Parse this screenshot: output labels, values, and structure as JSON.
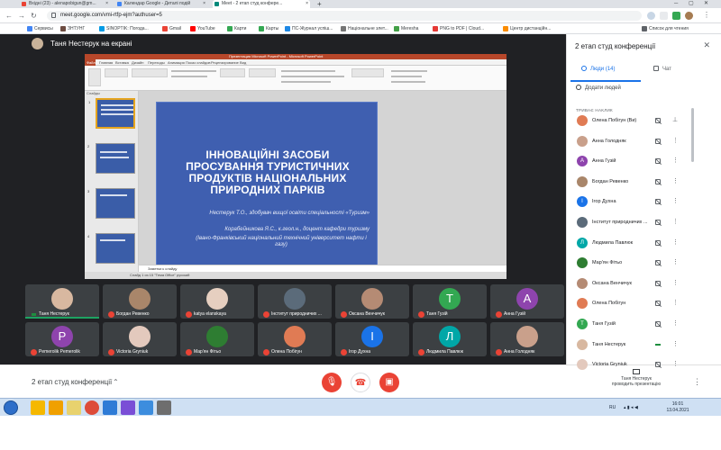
{
  "browser": {
    "tabs": [
      {
        "label": "Вхідні (23) - alenapobigun@gm...",
        "color": "#ea4335",
        "active": false
      },
      {
        "label": "Календар Google - Деталі подій",
        "color": "#4285f4",
        "active": false
      },
      {
        "label": "Meet - 2 етап студ конфере...",
        "color": "#00897b",
        "active": true
      }
    ],
    "new_tab": "+",
    "url": "meet.google.com/vmi-rtfp-ejm?authuser=5"
  },
  "bookmarks": [
    {
      "label": "Сервисы",
      "color": "#4285f4"
    },
    {
      "label": "ЗНТУНГ",
      "color": "#6d4c41"
    },
    {
      "label": "SINOPTIK: Погода...",
      "color": "#039be5"
    },
    {
      "label": "Gmail",
      "color": "#ea4335"
    },
    {
      "label": "YouTube",
      "color": "#ff0000"
    },
    {
      "label": "Карти",
      "color": "#34a853"
    },
    {
      "label": "Карты",
      "color": "#34a853"
    },
    {
      "label": "ПС-Журнал успіш...",
      "color": "#1e88e5"
    },
    {
      "label": "Національне злет...",
      "color": "#757575"
    },
    {
      "label": "Meresha",
      "color": "#43a047"
    },
    {
      "label": "PNG to PDF | Cloud...",
      "color": "#e53935"
    },
    {
      "label": "Центр дистанційн...",
      "color": "#fb8c00"
    },
    {
      "label": "Список для чтения",
      "color": "#5f6368"
    }
  ],
  "meet": {
    "presenter_label": "Таня Нестерук на екрані",
    "meeting_title": "2 етап студ конференції",
    "present_label_1": "Таня Нестерук",
    "present_label_2": "проводить презентацію"
  },
  "slide": {
    "app_title": "Презентация Microsoft PowerPoint - Microsoft PowerPoint",
    "tabs": [
      "Файл",
      "Главная",
      "Вставка",
      "Дизайн",
      "Переходы",
      "Анимация",
      "Показ слайдов",
      "Рецензирование",
      "Вид"
    ],
    "panel_header": "Слайды",
    "title_lines": [
      "ІННОВАЦІЙНІ ЗАСОБИ",
      "ПРОСУВАННЯ ТУРИСТИЧНИХ",
      "ПРОДУКТІВ НАЦІОНАЛЬНИХ",
      "ПРИРОДНИХ ПАРКІВ"
    ],
    "author_1": "Нестерук Т.О., здобувач вищої освіти спеціальності «Туризм»",
    "author_2": "Корабейникова Я.С., к.геол.н., доцент кафедри туризму",
    "author_3": "(Івано-Франківський національний технічний університет нафти і газу)",
    "notes": "Заметки к слайду",
    "status": "Слайд 1 из 15    \"Тема Office\"    русский"
  },
  "tiles": [
    {
      "name": "Таня Нестерук",
      "type": "photo",
      "color": "#d8b8a0",
      "speaking": true
    },
    {
      "name": "Богдан Ревенко",
      "type": "photo",
      "color": "#a9866a",
      "speaking": false
    },
    {
      "name": "katya elanskaya",
      "type": "photo",
      "color": "#e6cfc0",
      "speaking": false
    },
    {
      "name": "Інститут природничих ...",
      "type": "photo",
      "color": "#5b6b7a",
      "speaking": false
    },
    {
      "name": "Оксана Венчичук",
      "type": "photo",
      "color": "#b58b74",
      "speaking": false
    },
    {
      "name": "Таня Гузій",
      "type": "initial",
      "initial": "Т",
      "color": "#33a852",
      "speaking": false
    },
    {
      "name": "Анна Гузій",
      "type": "initial",
      "initial": "А",
      "color": "#8e44ad",
      "speaking": false
    },
    {
      "name": "Pemerolik Pemerolik",
      "type": "initial",
      "initial": "P",
      "color": "#8e44ad",
      "speaking": false
    },
    {
      "name": "Victoria Gryniuk",
      "type": "photo",
      "color": "#e3c9bd",
      "speaking": false
    },
    {
      "name": "Мар'ян Фітьо",
      "type": "photo",
      "color": "#2e7d32",
      "speaking": false
    },
    {
      "name": "Олена Побігун",
      "type": "photo",
      "color": "#e07b54",
      "speaking": false
    },
    {
      "name": "Ігор Духна",
      "type": "initial",
      "initial": "І",
      "color": "#1a73e8",
      "speaking": false
    },
    {
      "name": "Людмила Павлюк",
      "type": "initial",
      "initial": "Л",
      "color": "#00a7a7",
      "speaking": false
    },
    {
      "name": "Анна Голодняк",
      "type": "photo",
      "color": "#c9a08b",
      "speaking": false
    }
  ],
  "panel": {
    "title": "2 етап студ конференції",
    "tab_people": "Люди (14)",
    "tab_chat": "Чат",
    "add_people": "Додати людей",
    "section": "ТРИВАЄ НАКЛИК",
    "participants": [
      {
        "name": "Олена Побігун (Ви)",
        "color": "#e07b54",
        "initial": "",
        "speaking": false,
        "pin": true
      },
      {
        "name": "Анна Голодняк",
        "color": "#c9a08b",
        "initial": "",
        "speaking": false,
        "pin": false
      },
      {
        "name": "Анна Гузій",
        "color": "#8e44ad",
        "initial": "А",
        "speaking": false,
        "pin": false
      },
      {
        "name": "Богдан Ревенко",
        "color": "#a9866a",
        "initial": "",
        "speaking": false,
        "pin": false
      },
      {
        "name": "Ігор Духна",
        "color": "#1a73e8",
        "initial": "І",
        "speaking": false,
        "pin": false
      },
      {
        "name": "Інститут природничих ...",
        "color": "#5b6b7a",
        "initial": "",
        "speaking": false,
        "pin": false
      },
      {
        "name": "Людмила Павлюк",
        "color": "#00a7a7",
        "initial": "Л",
        "speaking": false,
        "pin": false
      },
      {
        "name": "Мар'ян Фітьо",
        "color": "#2e7d32",
        "initial": "",
        "speaking": false,
        "pin": false
      },
      {
        "name": "Оксана Венчичук",
        "color": "#b58b74",
        "initial": "",
        "speaking": false,
        "pin": false
      },
      {
        "name": "Олена Побігун",
        "color": "#e07b54",
        "initial": "",
        "speaking": false,
        "pin": false
      },
      {
        "name": "Таня Гузій",
        "color": "#33a852",
        "initial": "Т",
        "speaking": false,
        "pin": false
      },
      {
        "name": "Таня Нестерук",
        "color": "#d8b8a0",
        "initial": "",
        "speaking": true,
        "pin": false
      },
      {
        "name": "Victoria Gryniuk",
        "color": "#e3c9bd",
        "initial": "",
        "speaking": false,
        "pin": false
      }
    ]
  },
  "taskbar": {
    "apps": [
      "#f5b800",
      "#f0a000",
      "#e8d26e",
      "#dd4b39",
      "#2e7bd6",
      "#7a4ed6",
      "#3c8dde",
      "#6e6e6e"
    ],
    "lang": "RU",
    "time": "16:01",
    "date": "13.04.2021"
  }
}
